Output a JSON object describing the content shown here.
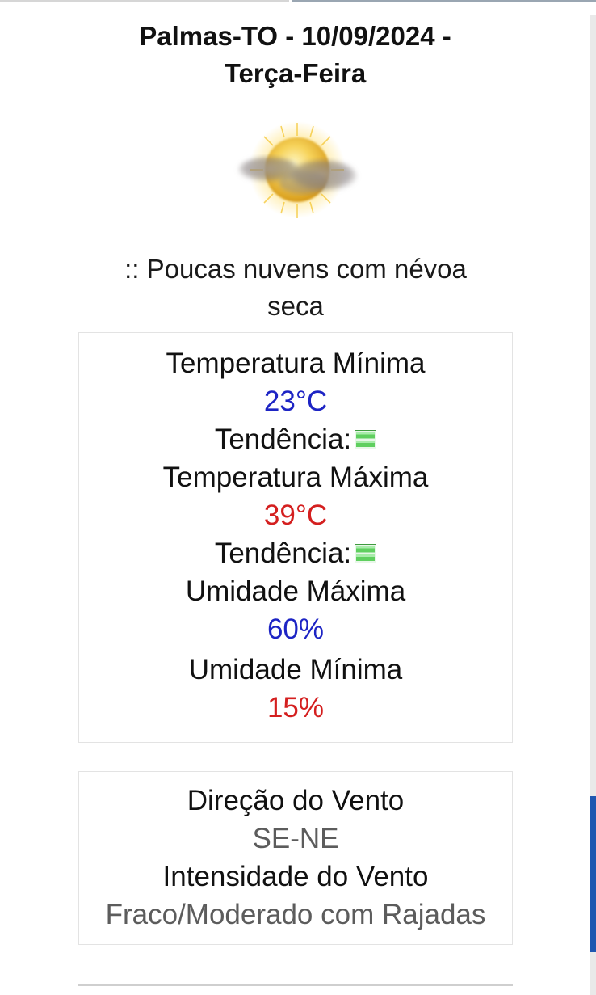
{
  "header": {
    "title_line1": "Palmas-TO - 10/09/2024 -",
    "title_line2": "Terça-Feira"
  },
  "weather_icon": "sun-with-haze-cloud-icon",
  "description_line1": ":: Poucas nuvens com névoa",
  "description_line2": "seca",
  "temperature_card": {
    "min_label": "Temperatura Mínima",
    "min_value": "23°C",
    "min_trend_label": "Tendência:",
    "max_label": "Temperatura Máxima",
    "max_value": "39°C",
    "max_trend_label": "Tendência:",
    "humidity_max_label": "Umidade Máxima",
    "humidity_max_value": "60%",
    "humidity_min_label": "Umidade Mínima",
    "humidity_min_value": "15%",
    "trend_icon": "stable-trend-icon"
  },
  "wind_card": {
    "direction_label": "Direção do Vento",
    "direction_value": "SE-NE",
    "intensity_label": "Intensidade do Vento",
    "intensity_value": "Fraco/Moderado com Rajadas"
  },
  "colors": {
    "min_value": "#1d24c4",
    "max_value": "#d41f1f",
    "wind_value": "#5c5c5c",
    "trend_icon": "#4cc24c",
    "scroll_thumb": "#1f57b0"
  }
}
